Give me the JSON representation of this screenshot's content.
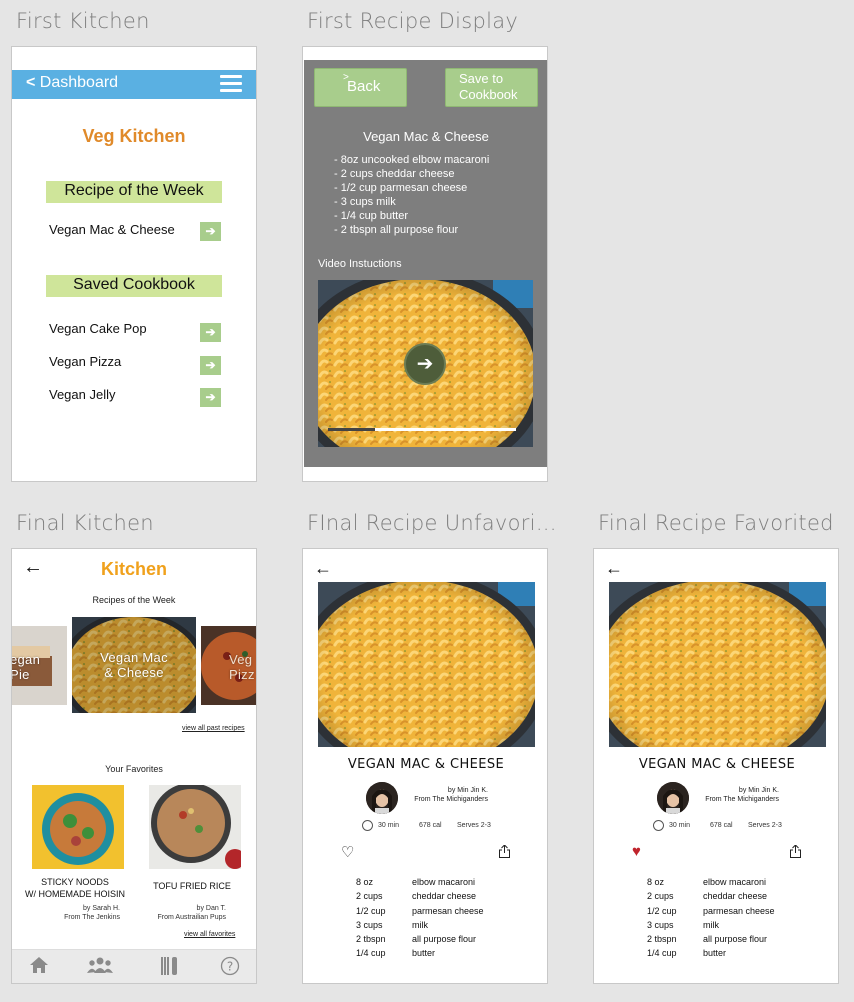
{
  "boards": {
    "first_kitchen": "First Kitchen",
    "first_recipe": "First Recipe Display",
    "final_kitchen": "Final Kitchen",
    "final_unfav": "FInal Recipe Unfavori...",
    "final_fav": "Final Recipe Favorited"
  },
  "first_kitchen": {
    "nav_back": "Dashboard",
    "title": "Veg Kitchen",
    "section_week": "Recipe of the Week",
    "week_item": "Vegan Mac & Cheese",
    "section_saved": "Saved Cookbook",
    "saved_items": [
      "Vegan Cake Pop",
      "Vegan Pizza",
      "Vegan Jelly"
    ],
    "colors": {
      "nav": "#5ab0e2",
      "title": "#e08a2a",
      "band": "#cfe59a",
      "arrow": "#a8cd8c"
    }
  },
  "first_recipe": {
    "back_label": "Back",
    "save_label": "Save to Cookbook",
    "title": "Vegan Mac & Cheese",
    "ingredients": [
      "- 8oz uncooked elbow macaroni",
      "- 2 cups cheddar cheese",
      "- 1/2 cup parmesan cheese",
      "- 3 cups milk",
      "- 1/4 cup butter",
      "- 2 tbspn all purpose flour"
    ],
    "video_label": "Video Instuctions",
    "video_progress": 0.25,
    "play_icon": "arrow-right-icon"
  },
  "final_kitchen": {
    "title": "Kitchen",
    "week_heading": "Recipes of the Week",
    "carousel": {
      "left": "egan\nPie",
      "center": "Vegan Mac\n& Cheese",
      "right": "Veg\nPizz"
    },
    "view_past": "view all past recipes",
    "favorites_heading": "Your Favorites",
    "favorites": [
      {
        "name": "STICKY NOODS\nW/ HOMEMADE HOISIN",
        "by": "by Sarah H.",
        "from": "From The Jenkins"
      },
      {
        "name": "TOFU FRIED RICE",
        "by": "by Dan T.",
        "from": "From Austrailian Pups"
      }
    ],
    "view_favorites": "view all favorites",
    "tabs": [
      "home-icon",
      "community-icon",
      "kitchen-icon",
      "help-icon"
    ]
  },
  "recipe": {
    "title": "VEGAN MAC & CHEESE",
    "author": "by Min Jin K.",
    "from": "From The Michiganders",
    "time": "30 min",
    "calories": "678 cal",
    "serves": "Serves 2-3",
    "ingredients": [
      {
        "qty": "8 oz",
        "item": "elbow macaroni"
      },
      {
        "qty": "2 cups",
        "item": "cheddar cheese"
      },
      {
        "qty": "1/2 cup",
        "item": "parmesan cheese"
      },
      {
        "qty": "3 cups",
        "item": "milk"
      },
      {
        "qty": "2 tbspn",
        "item": "all purpose flour"
      },
      {
        "qty": "1/4 cup",
        "item": "butter"
      }
    ],
    "heart_color_fav": "#c0242c"
  }
}
